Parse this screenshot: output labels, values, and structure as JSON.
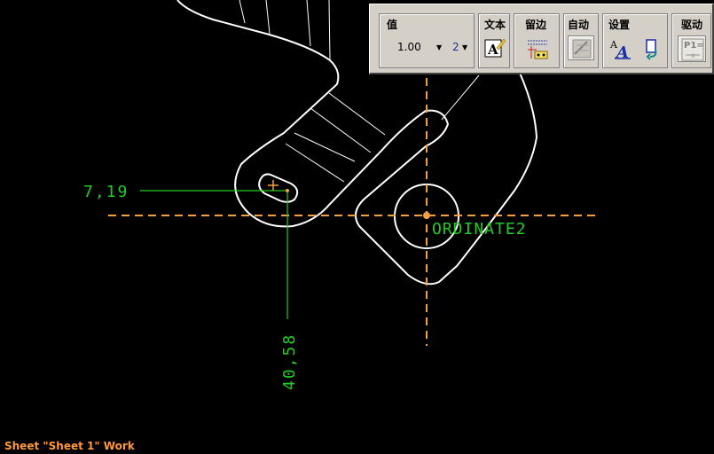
{
  "toolbar": {
    "value_group": {
      "title": "值",
      "precision_value": "1.00",
      "decimals_value": "2"
    },
    "text_group": {
      "title": "文本",
      "icon": "text-edit-icon"
    },
    "margin_group": {
      "title": "留边",
      "icon": "margin-icon"
    },
    "auto_group": {
      "title": "自动",
      "icon": "auto-dimension-icon"
    },
    "settings_group": {
      "title": "设置",
      "icons": [
        "text-style-icon",
        "reset-settings-icon"
      ]
    },
    "drive_group": {
      "title": "驱动",
      "icon": "driving-dimension-icon",
      "icon_text": "P1="
    }
  },
  "drawing": {
    "dim_horizontal": "7,19",
    "dim_vertical": "40,58",
    "ordinate_label": "ORDINATE2"
  },
  "status_bar": {
    "text": "Sheet \"Sheet 1\" Work"
  },
  "colors": {
    "background": "#000000",
    "geometry": "#ffffff",
    "dimension": "#22cc22",
    "centerline": "#f5a040",
    "status_text": "#ff9a3c",
    "toolbar_bg": "#d4d0c8"
  }
}
